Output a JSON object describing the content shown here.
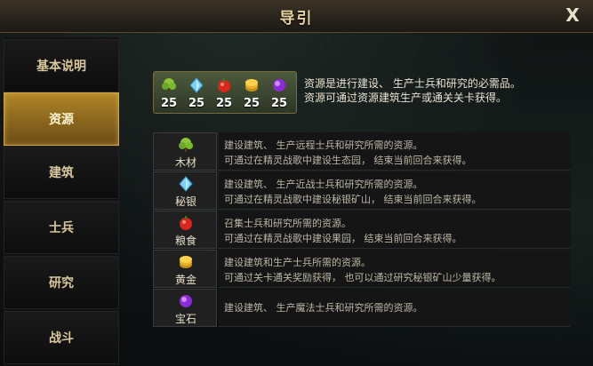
{
  "window": {
    "title": "导引",
    "close_label": "X"
  },
  "sidebar": {
    "items": [
      {
        "label": "基本说明",
        "active": false
      },
      {
        "label": "资源",
        "active": true
      },
      {
        "label": "建筑",
        "active": false
      },
      {
        "label": "士兵",
        "active": false
      },
      {
        "label": "研究",
        "active": false
      },
      {
        "label": "战斗",
        "active": false
      }
    ]
  },
  "banner": {
    "resources": [
      {
        "icon": "wood-icon",
        "value": "25"
      },
      {
        "icon": "mithril-icon",
        "value": "25"
      },
      {
        "icon": "food-icon",
        "value": "25"
      },
      {
        "icon": "gold-icon",
        "value": "25"
      },
      {
        "icon": "gem-icon",
        "value": "25"
      }
    ]
  },
  "intro": {
    "line1": "资源是进行建设、 生产士兵和研究的必需品。",
    "line2": "资源可通过资源建筑生产或通关关卡获得。"
  },
  "resources": [
    {
      "name": "木材",
      "icon": "wood-icon",
      "line1": "建设建筑、 生产远程士兵和研究所需的资源。",
      "line2": "可通过在精灵战歌中建设生态园， 结束当前回合来获得。"
    },
    {
      "name": "秘银",
      "icon": "mithril-icon",
      "line1": "建设建筑、 生产近战士兵和研究所需的资源。",
      "line2": "可通过在精灵战歌中建设秘银矿山， 结束当前回合来获得。"
    },
    {
      "name": "粮食",
      "icon": "food-icon",
      "line1": "召集士兵和研究所需的资源。",
      "line2": "可通过在精灵战歌中建设果园， 结束当前回合来获得。"
    },
    {
      "name": "黄金",
      "icon": "gold-icon",
      "line1": "建设建筑和生产士兵所需的资源。",
      "line2": "可通过关卡通关奖励获得， 也可以通过研究秘银矿山少量获得。"
    },
    {
      "name": "宝石",
      "icon": "gem-icon",
      "line1": "建设建筑、 生产魔法士兵和研究所需的资源。",
      "line2": ""
    }
  ],
  "colors": {
    "accent_gold": "#b08628",
    "text_light": "#e8e2d2",
    "text_muted": "#bdb6a6"
  }
}
